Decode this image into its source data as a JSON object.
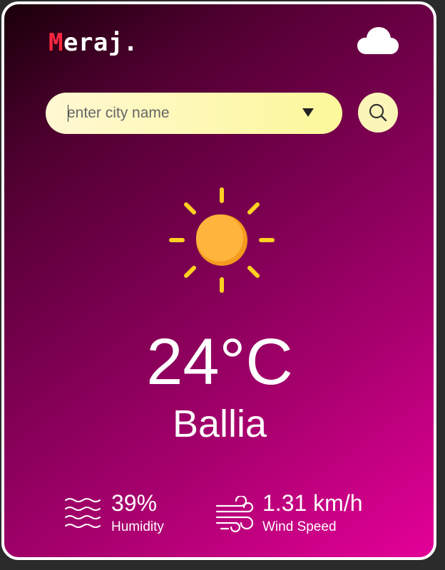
{
  "brand": {
    "logo_initial": "M",
    "logo_rest": "eraj.",
    "accent_color": "#ff2740",
    "logo_icon": "cloud-icon"
  },
  "search": {
    "placeholder": "enter city name",
    "value": "",
    "dropdown_icon": "triangle-down-icon",
    "button_icon": "search-icon",
    "pill_color": "#fcf89a"
  },
  "weather": {
    "condition_icon": "sun-icon",
    "temperature": "24°C",
    "city": "Ballia"
  },
  "stats": {
    "humidity": {
      "icon": "waves-icon",
      "value": "39%",
      "label": "Humidity"
    },
    "wind": {
      "icon": "wind-icon",
      "value": "1.31 km/h",
      "label": "Wind Speed"
    }
  },
  "theme": {
    "gradient_start": "#1a0009",
    "gradient_end": "#e40098",
    "sun_color": "#ffb030",
    "ray_color": "#ffd020"
  }
}
